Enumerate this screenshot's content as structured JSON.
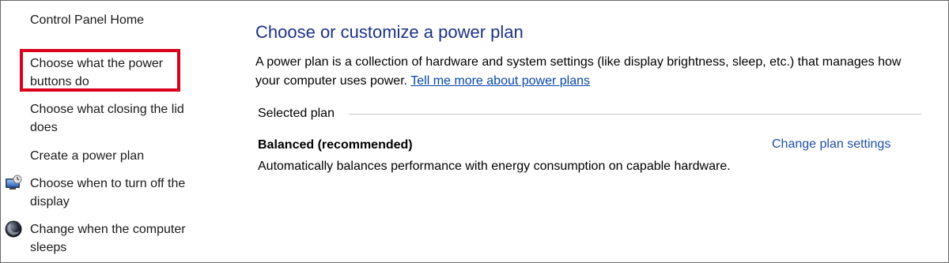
{
  "sidebar": {
    "home": "Control Panel Home",
    "items": [
      {
        "line1": "Choose what the power",
        "line2": "buttons do"
      },
      {
        "line1": "Choose what closing the lid",
        "line2": "does"
      },
      {
        "line1": "Create a power plan"
      },
      {
        "line1": "Choose when to turn off the",
        "line2": "display",
        "icon": "display-settings-icon"
      },
      {
        "line1": "Change when the computer",
        "line2": "sleeps",
        "icon": "moon-sleep-icon"
      }
    ],
    "highlight_color": "#d9001b"
  },
  "main": {
    "title": "Choose or customize a power plan",
    "description": "A power plan is a collection of hardware and system settings (like display brightness, sleep, etc.) that manages how your computer uses power.",
    "learn_more_link": "Tell me more about power plans",
    "section_label": "Selected plan",
    "plan": {
      "name": "Balanced (recommended)",
      "change_link": "Change plan settings",
      "description": "Automatically balances performance with energy consumption on capable hardware."
    }
  },
  "colors": {
    "title": "#1e3287",
    "link": "#0645ad"
  }
}
